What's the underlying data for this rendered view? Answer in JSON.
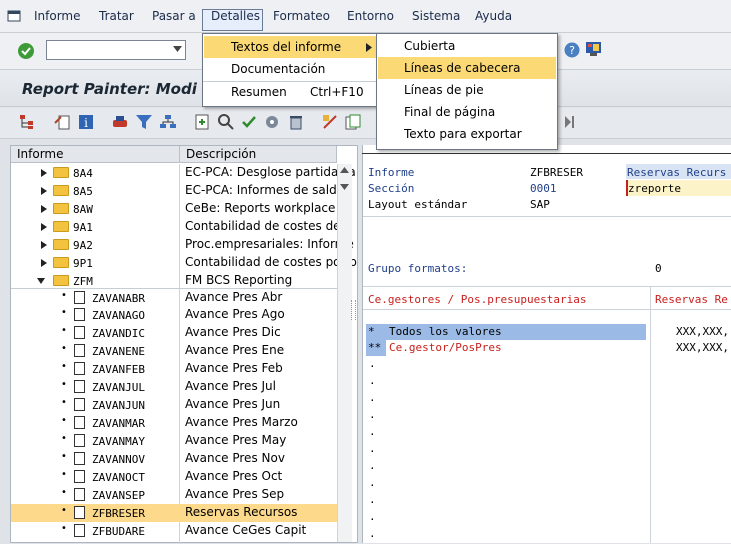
{
  "menubar": {
    "items": [
      "Informe",
      "Tratar",
      "Pasar a",
      "Detalles",
      "Formateo",
      "Entorno",
      "Sistema",
      "Ayuda"
    ]
  },
  "title": "Report Painter: Modi",
  "detalles_menu": {
    "items": [
      {
        "label": "Textos del informe",
        "shortcut": ""
      },
      {
        "label": "Documentación",
        "shortcut": ""
      },
      {
        "label": "Resumen",
        "shortcut": "Ctrl+F10"
      }
    ]
  },
  "textos_submenu": {
    "items": [
      "Cubierta",
      "Líneas de cabecera",
      "Líneas de pie",
      "Final de página",
      "Texto para exportar"
    ],
    "highlighted": "Líneas de cabecera"
  },
  "tree": {
    "col_informe": "Informe",
    "col_descripcion": "Descripción",
    "folders": [
      {
        "key": "8A4",
        "desc": "EC-PCA: Desglose partidas a"
      },
      {
        "key": "8A5",
        "desc": "EC-PCA: Informes de saldos"
      },
      {
        "key": "8AW",
        "desc": "CeBe: Reports workplace"
      },
      {
        "key": "9A1",
        "desc": "Contabilidad de costes de p"
      },
      {
        "key": "9A2",
        "desc": "Proc.empresariales: Informe"
      },
      {
        "key": "9P1",
        "desc": "Contabilidad de costes por p"
      },
      {
        "key": "ZFM",
        "desc": "FM BCS Reporting"
      }
    ],
    "reports": [
      {
        "key": "ZAVANABR",
        "desc": "Avance Pres Abr"
      },
      {
        "key": "ZAVANAGO",
        "desc": "Avance Pres Ago"
      },
      {
        "key": "ZAVANDIC",
        "desc": "Avance Pres Dic"
      },
      {
        "key": "ZAVANENE",
        "desc": "Avance Pres Ene"
      },
      {
        "key": "ZAVANFEB",
        "desc": "Avance Pres Feb"
      },
      {
        "key": "ZAVANJUL",
        "desc": "Avance Pres Jul"
      },
      {
        "key": "ZAVANJUN",
        "desc": "Avance Pres Jun"
      },
      {
        "key": "ZAVANMAR",
        "desc": "Avance Pres Marzo"
      },
      {
        "key": "ZAVANMAY",
        "desc": "Avance Pres May"
      },
      {
        "key": "ZAVANNOV",
        "desc": "Avance Pres Nov"
      },
      {
        "key": "ZAVANOCT",
        "desc": "Avance Pres Oct"
      },
      {
        "key": "ZAVANSEP",
        "desc": "Avance Pres Sep"
      },
      {
        "key": "ZFBRESER",
        "desc": "Reservas Recursos"
      },
      {
        "key": "ZFBUDARE",
        "desc": "Avance CeGes Capit"
      }
    ],
    "selected": "ZFBRESER"
  },
  "report": {
    "informe_label": "Informe",
    "informe_value": "ZFBRESER",
    "informe_desc": "Reservas Recurs",
    "seccion_label": "Sección",
    "seccion_value": "0001",
    "seccion_desc": "zreporte",
    "layout_label": "Layout estándar",
    "layout_value": "SAP",
    "grupo_label": "Grupo formatos:",
    "grupo_value": "0",
    "col1_header": "Ce.gestores / Pos.presupuestarias",
    "col2_header": "Reservas Re",
    "rows": [
      {
        "prefix": "*",
        "label": "Todos los valores",
        "value": "XXX,XXX,"
      },
      {
        "prefix": "**",
        "label": "Ce.gestor/PosPres",
        "value": "XXX,XXX,"
      }
    ],
    "dots": [
      ".",
      ".",
      ".",
      ".",
      ".",
      ".",
      ".",
      ".",
      ".",
      ".",
      "."
    ]
  },
  "colors": {
    "highlight": "#fbd974",
    "selected_row": "#fcd98b",
    "red_text": "#c8201e",
    "blue_row": "#9bbbe6"
  }
}
